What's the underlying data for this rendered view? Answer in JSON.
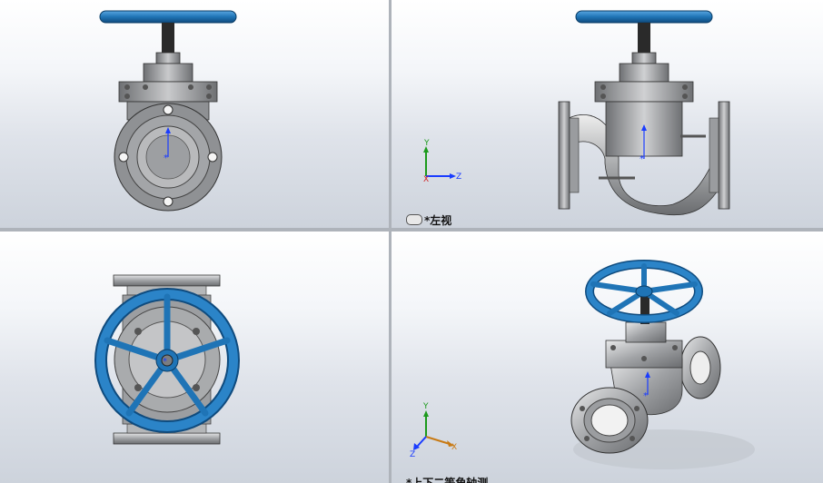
{
  "views": {
    "top_right": {
      "label": "*左视"
    },
    "bottom_right": {
      "label": "*上下二等角轴测"
    }
  },
  "triad": {
    "x": "X",
    "y": "Y",
    "z": "Z"
  },
  "colors": {
    "handwheel": "#1f74b6",
    "body": "#a7a9ac",
    "background_top": "#ffffff",
    "background_bottom": "#cdd3dc"
  }
}
